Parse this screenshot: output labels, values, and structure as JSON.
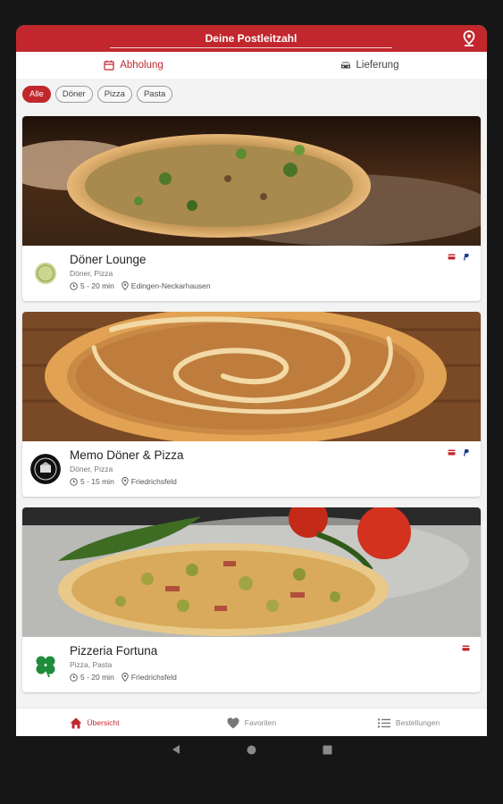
{
  "header": {
    "postcode_placeholder": "Deine Postleitzahl",
    "location_icon": "location-pin-icon"
  },
  "modes": {
    "pickup": "Abholung",
    "delivery": "Lieferung",
    "active": "pickup"
  },
  "filters": [
    "Alle",
    "Döner",
    "Pizza",
    "Pasta"
  ],
  "restaurants": [
    {
      "name": "Döner Lounge",
      "categories": "Döner, Pizza",
      "time": "5 - 20 min",
      "location": "Edingen-Neckarhausen",
      "payments": [
        "card-icon",
        "paypal-icon"
      ]
    },
    {
      "name": "Memo Döner & Pizza",
      "categories": "Döner, Pizza",
      "time": "5 - 15 min",
      "location": "Friedrichsfeld",
      "payments": [
        "card-icon",
        "paypal-icon"
      ]
    },
    {
      "name": "Pizzeria Fortuna",
      "categories": "Pizza, Pasta",
      "time": "5 - 20 min",
      "location": "Friedrichsfeld",
      "payments": [
        "card-icon"
      ]
    }
  ],
  "bottom_nav": {
    "overview": "Übersicht",
    "favorites": "Favoriten",
    "orders": "Bestellungen",
    "active": "overview"
  },
  "colors": {
    "accent": "#c1272d",
    "background": "#f3f3f3"
  }
}
